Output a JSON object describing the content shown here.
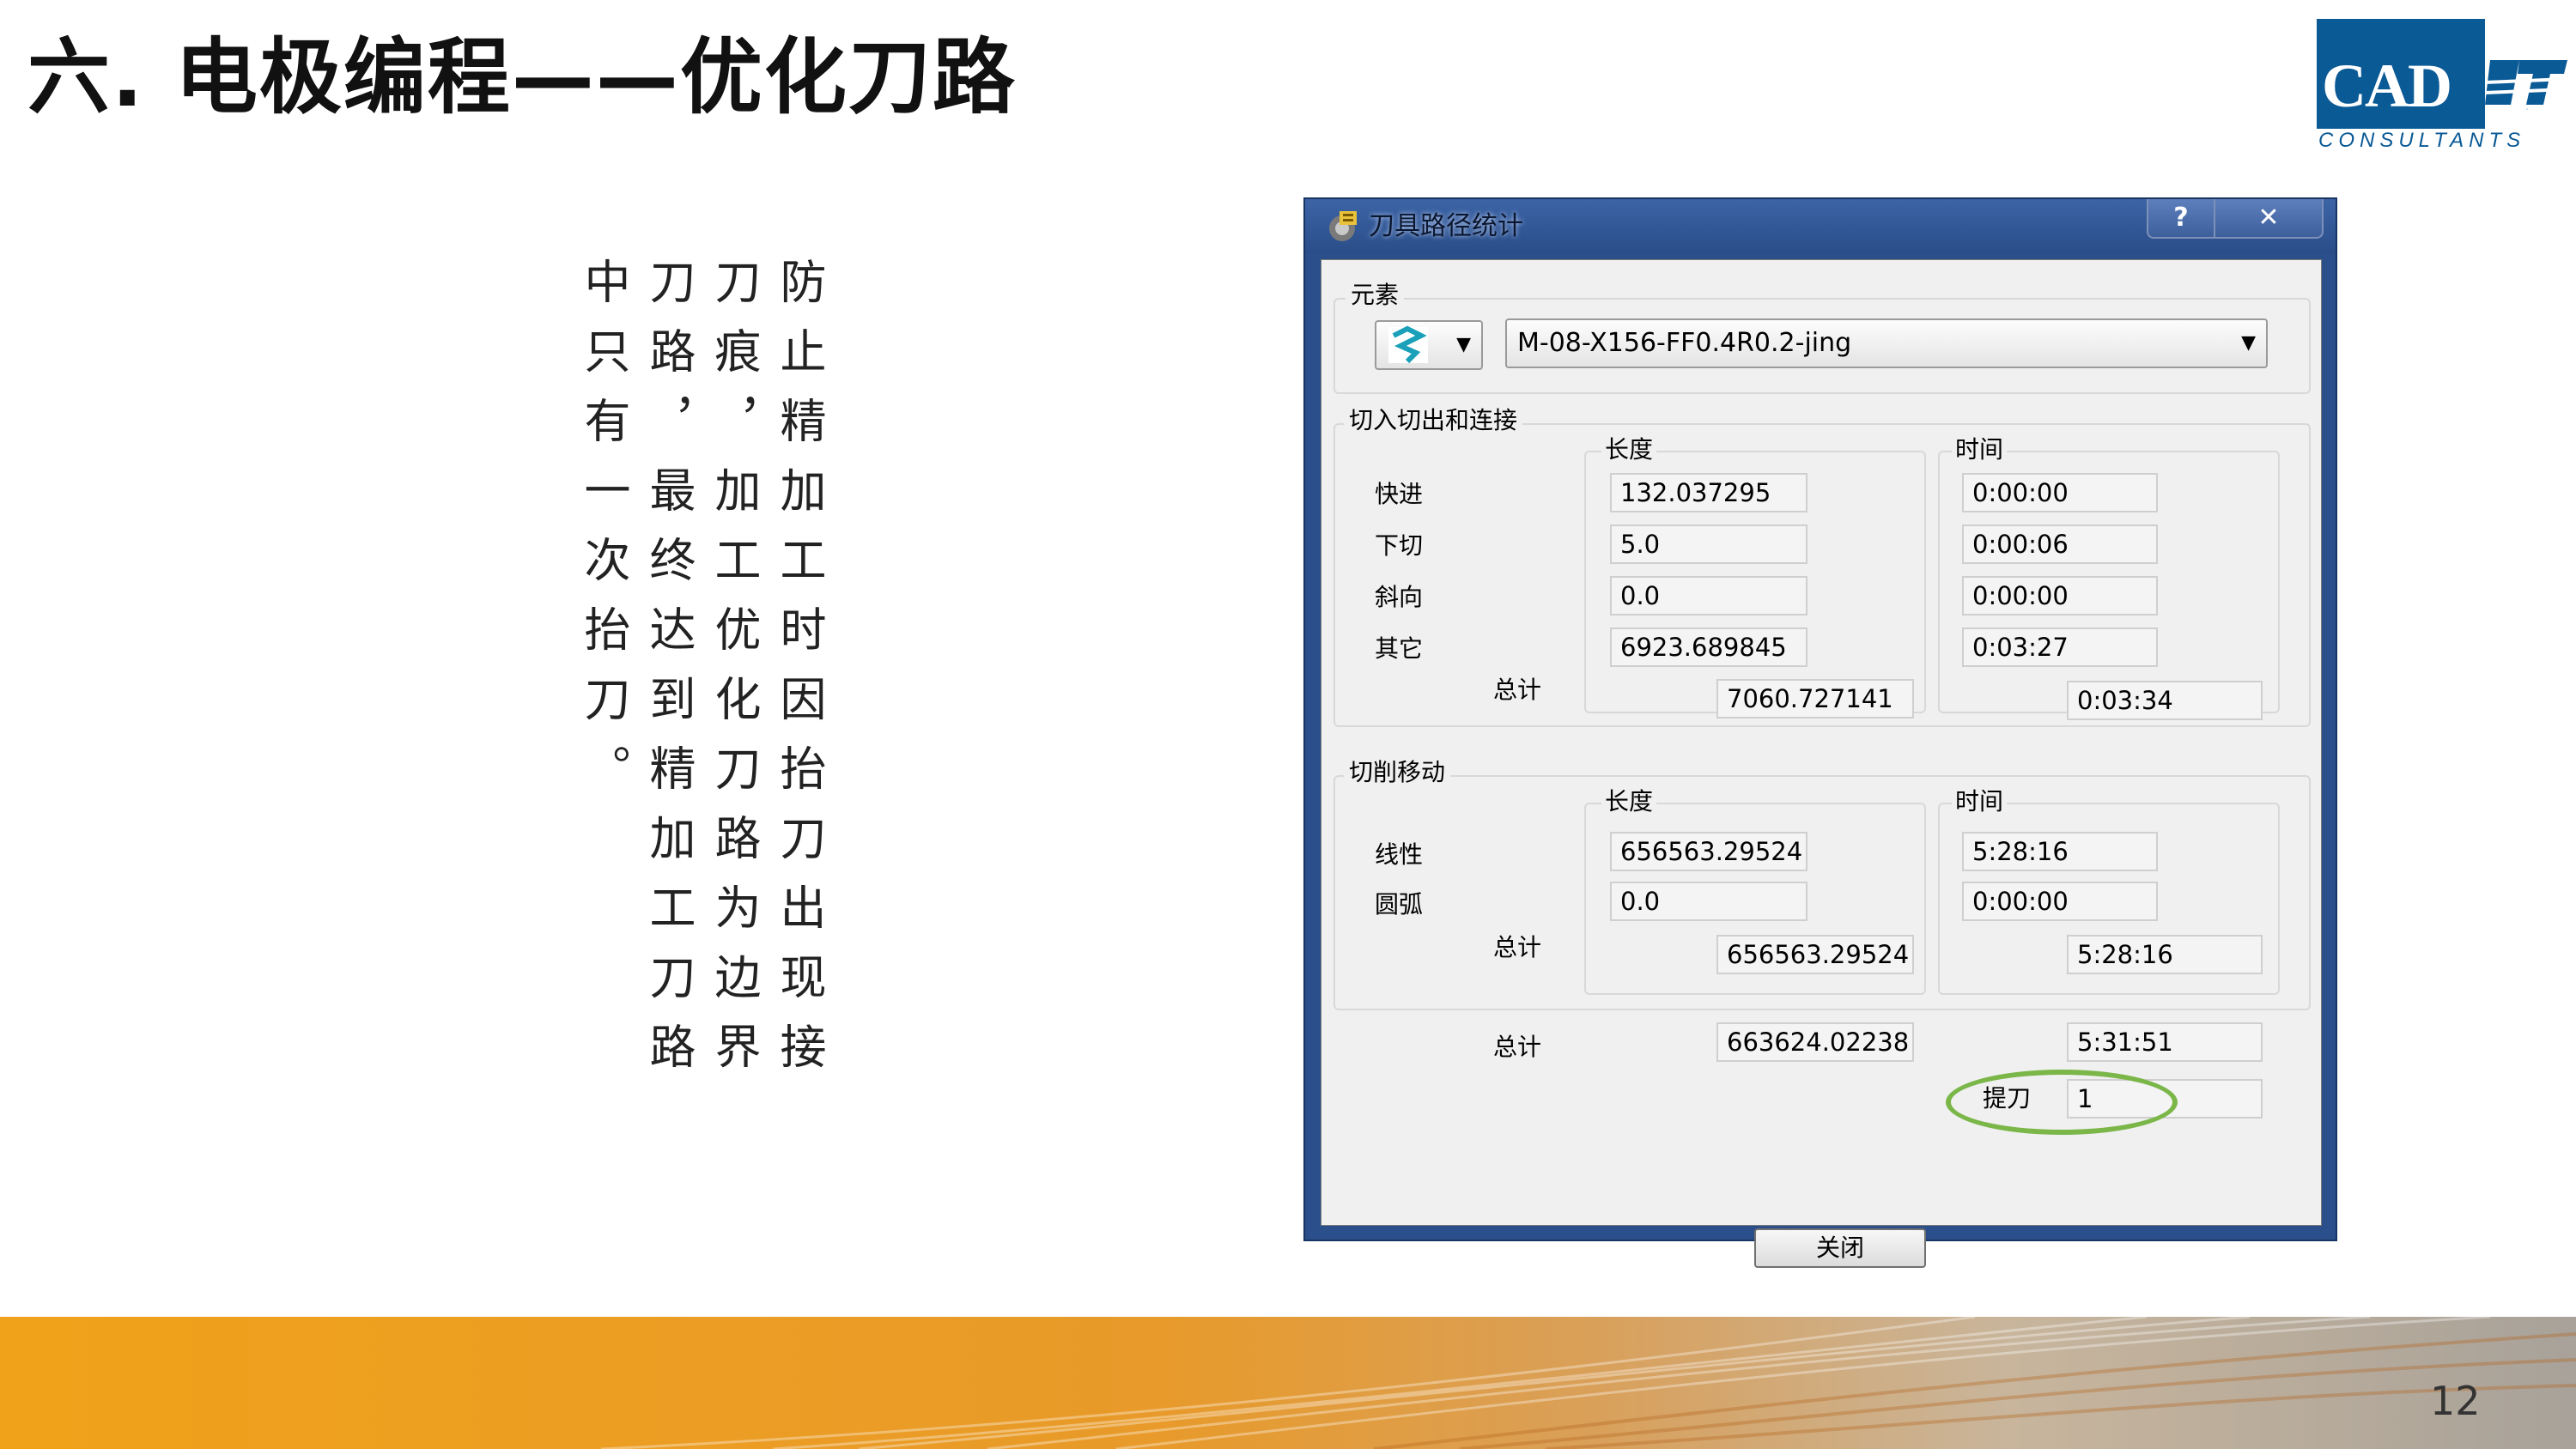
{
  "slide": {
    "title": "六. 电极编程——优化刀路",
    "page_number": "12",
    "body_text": "防止精加工时因抬刀出现接刀痕，加工优化刀路为边界刀路，最终达到精加工刀路中只有一次抬刀。"
  },
  "logo": {
    "main": "CAD",
    "suffix": "IT",
    "sub": "CONSULTANTS",
    "primary_color": "#0a5a96"
  },
  "dialog": {
    "title": "刀具路径统计",
    "help_button": "?",
    "close_icon": "✕",
    "element_group": {
      "label": "元素",
      "icon": "toolpath-icon",
      "selected": "M-08-X156-FF0.4R0.2-jing"
    },
    "links_group": {
      "label": "切入切出和连接",
      "length_header": "长度",
      "time_header": "时间",
      "rows": [
        {
          "label": "快进",
          "length": "132.037295",
          "time": "0:00:00"
        },
        {
          "label": "下切",
          "length": "5.0",
          "time": "0:00:06"
        },
        {
          "label": "斜向",
          "length": "0.0",
          "time": "0:00:00"
        },
        {
          "label": "其它",
          "length": "6923.689845",
          "time": "0:03:27"
        }
      ],
      "total_label": "总计",
      "total_length": "7060.727141",
      "total_time": "0:03:34"
    },
    "cutting_group": {
      "label": "切削移动",
      "length_header": "长度",
      "time_header": "时间",
      "rows": [
        {
          "label": "线性",
          "length": "656563.29524",
          "time": "5:28:16"
        },
        {
          "label": "圆弧",
          "length": "0.0",
          "time": "0:00:00"
        }
      ],
      "total_label": "总计",
      "total_length": "656563.29524",
      "total_time": "5:28:16"
    },
    "grand_total": {
      "label": "总计",
      "length": "663624.02238",
      "time": "5:31:51"
    },
    "retracts": {
      "label": "提刀",
      "value": "1"
    },
    "close_button": "关闭",
    "highlight_color": "#7ab648"
  }
}
